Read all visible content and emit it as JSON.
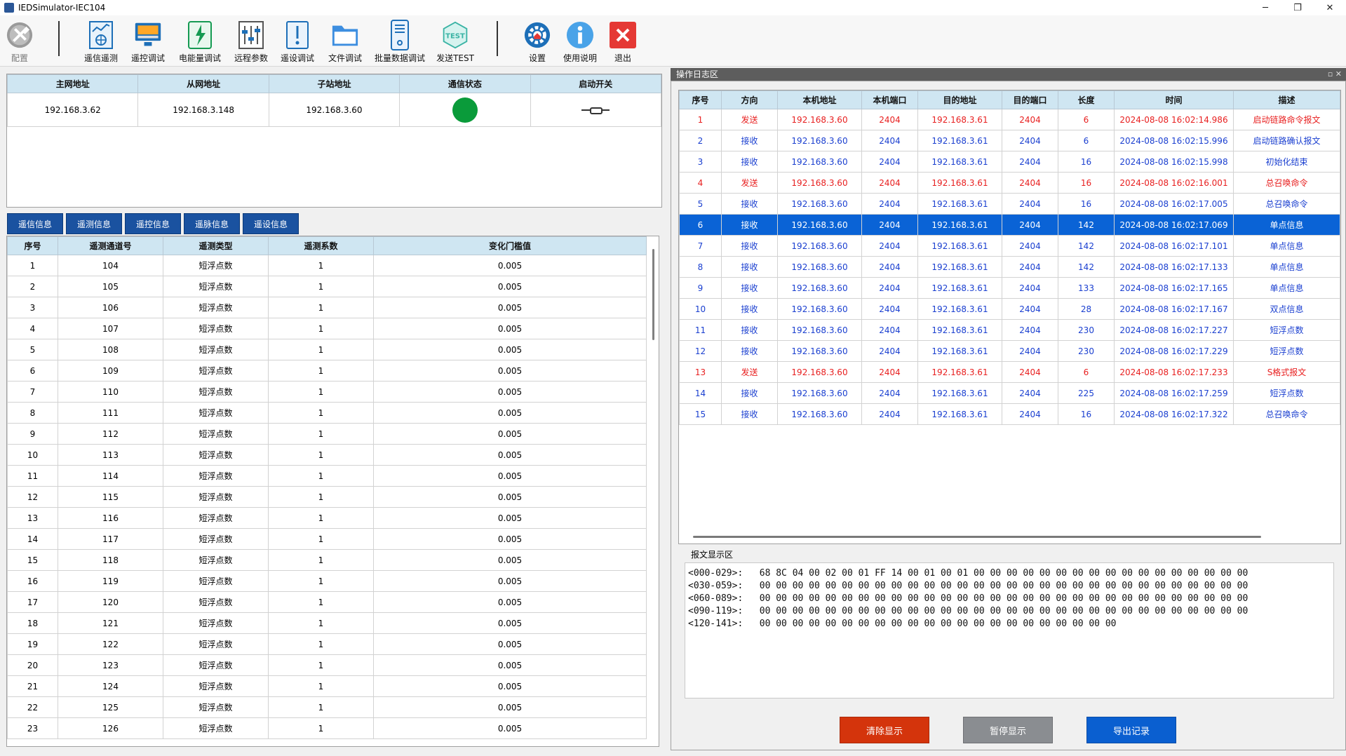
{
  "window": {
    "title": "IEDSimulator-IEC104",
    "minimize": "─",
    "maximize": "❐",
    "close": "✕"
  },
  "toolbar": {
    "items": [
      {
        "label": "配置",
        "icon": "config-tools-icon"
      },
      {
        "label": "遥信遥测",
        "icon": "chart-monitor-icon"
      },
      {
        "label": "遥控调试",
        "icon": "remote-screen-icon"
      },
      {
        "label": "电能量调试",
        "icon": "energy-meter-icon"
      },
      {
        "label": "远程参数",
        "icon": "sliders-icon"
      },
      {
        "label": "遥设调试",
        "icon": "alert-doc-icon"
      },
      {
        "label": "文件调试",
        "icon": "folder-icon"
      },
      {
        "label": "批量数据调试",
        "icon": "server-icon"
      },
      {
        "label": "发送TEST",
        "icon": "test-badge-icon"
      },
      {
        "label": "设置",
        "icon": "settings-icon"
      },
      {
        "label": "使用说明",
        "icon": "info-icon"
      },
      {
        "label": "退出",
        "icon": "exit-icon"
      }
    ]
  },
  "connection": {
    "headers": [
      "主网地址",
      "从网地址",
      "子站地址",
      "通信状态",
      "启动开关"
    ],
    "row": {
      "master": "192.168.3.62",
      "slave": "192.168.3.148",
      "substation": "192.168.3.60",
      "status_color": "#0a9b3a"
    }
  },
  "tabs": [
    "遥信信息",
    "遥测信息",
    "遥控信息",
    "遥脉信息",
    "遥设信息"
  ],
  "telemetry": {
    "headers": [
      "序号",
      "遥测通道号",
      "遥测类型",
      "遥测系数",
      "变化门槛值"
    ],
    "rows": [
      [
        "1",
        "104",
        "短浮点数",
        "1",
        "0.005"
      ],
      [
        "2",
        "105",
        "短浮点数",
        "1",
        "0.005"
      ],
      [
        "3",
        "106",
        "短浮点数",
        "1",
        "0.005"
      ],
      [
        "4",
        "107",
        "短浮点数",
        "1",
        "0.005"
      ],
      [
        "5",
        "108",
        "短浮点数",
        "1",
        "0.005"
      ],
      [
        "6",
        "109",
        "短浮点数",
        "1",
        "0.005"
      ],
      [
        "7",
        "110",
        "短浮点数",
        "1",
        "0.005"
      ],
      [
        "8",
        "111",
        "短浮点数",
        "1",
        "0.005"
      ],
      [
        "9",
        "112",
        "短浮点数",
        "1",
        "0.005"
      ],
      [
        "10",
        "113",
        "短浮点数",
        "1",
        "0.005"
      ],
      [
        "11",
        "114",
        "短浮点数",
        "1",
        "0.005"
      ],
      [
        "12",
        "115",
        "短浮点数",
        "1",
        "0.005"
      ],
      [
        "13",
        "116",
        "短浮点数",
        "1",
        "0.005"
      ],
      [
        "14",
        "117",
        "短浮点数",
        "1",
        "0.005"
      ],
      [
        "15",
        "118",
        "短浮点数",
        "1",
        "0.005"
      ],
      [
        "16",
        "119",
        "短浮点数",
        "1",
        "0.005"
      ],
      [
        "17",
        "120",
        "短浮点数",
        "1",
        "0.005"
      ],
      [
        "18",
        "121",
        "短浮点数",
        "1",
        "0.005"
      ],
      [
        "19",
        "122",
        "短浮点数",
        "1",
        "0.005"
      ],
      [
        "20",
        "123",
        "短浮点数",
        "1",
        "0.005"
      ],
      [
        "21",
        "124",
        "短浮点数",
        "1",
        "0.005"
      ],
      [
        "22",
        "125",
        "短浮点数",
        "1",
        "0.005"
      ],
      [
        "23",
        "126",
        "短浮点数",
        "1",
        "0.005"
      ]
    ]
  },
  "log": {
    "title": "操作日志区",
    "title_controls": "▫ ✕",
    "headers": [
      "序号",
      "方向",
      "本机地址",
      "本机端口",
      "目的地址",
      "目的端口",
      "长度",
      "时间",
      "描述"
    ],
    "selected_index": 5,
    "rows": [
      {
        "dir": "send",
        "cells": [
          "1",
          "发送",
          "192.168.3.60",
          "2404",
          "192.168.3.61",
          "2404",
          "6",
          "2024-08-08 16:02:14.986",
          "启动链路命令报文"
        ]
      },
      {
        "dir": "recv",
        "cells": [
          "2",
          "接收",
          "192.168.3.60",
          "2404",
          "192.168.3.61",
          "2404",
          "6",
          "2024-08-08 16:02:15.996",
          "启动链路确认报文"
        ]
      },
      {
        "dir": "recv",
        "cells": [
          "3",
          "接收",
          "192.168.3.60",
          "2404",
          "192.168.3.61",
          "2404",
          "16",
          "2024-08-08 16:02:15.998",
          "初始化结束"
        ]
      },
      {
        "dir": "send",
        "cells": [
          "4",
          "发送",
          "192.168.3.60",
          "2404",
          "192.168.3.61",
          "2404",
          "16",
          "2024-08-08 16:02:16.001",
          "总召唤命令"
        ]
      },
      {
        "dir": "recv",
        "cells": [
          "5",
          "接收",
          "192.168.3.60",
          "2404",
          "192.168.3.61",
          "2404",
          "16",
          "2024-08-08 16:02:17.005",
          "总召唤命令"
        ]
      },
      {
        "dir": "recv",
        "cells": [
          "6",
          "接收",
          "192.168.3.60",
          "2404",
          "192.168.3.61",
          "2404",
          "142",
          "2024-08-08 16:02:17.069",
          "单点信息"
        ]
      },
      {
        "dir": "recv",
        "cells": [
          "7",
          "接收",
          "192.168.3.60",
          "2404",
          "192.168.3.61",
          "2404",
          "142",
          "2024-08-08 16:02:17.101",
          "单点信息"
        ]
      },
      {
        "dir": "recv",
        "cells": [
          "8",
          "接收",
          "192.168.3.60",
          "2404",
          "192.168.3.61",
          "2404",
          "142",
          "2024-08-08 16:02:17.133",
          "单点信息"
        ]
      },
      {
        "dir": "recv",
        "cells": [
          "9",
          "接收",
          "192.168.3.60",
          "2404",
          "192.168.3.61",
          "2404",
          "133",
          "2024-08-08 16:02:17.165",
          "单点信息"
        ]
      },
      {
        "dir": "recv",
        "cells": [
          "10",
          "接收",
          "192.168.3.60",
          "2404",
          "192.168.3.61",
          "2404",
          "28",
          "2024-08-08 16:02:17.167",
          "双点信息"
        ]
      },
      {
        "dir": "recv",
        "cells": [
          "11",
          "接收",
          "192.168.3.60",
          "2404",
          "192.168.3.61",
          "2404",
          "230",
          "2024-08-08 16:02:17.227",
          "短浮点数"
        ]
      },
      {
        "dir": "recv",
        "cells": [
          "12",
          "接收",
          "192.168.3.60",
          "2404",
          "192.168.3.61",
          "2404",
          "230",
          "2024-08-08 16:02:17.229",
          "短浮点数"
        ]
      },
      {
        "dir": "send",
        "cells": [
          "13",
          "发送",
          "192.168.3.60",
          "2404",
          "192.168.3.61",
          "2404",
          "6",
          "2024-08-08 16:02:17.233",
          "S格式报文"
        ]
      },
      {
        "dir": "recv",
        "cells": [
          "14",
          "接收",
          "192.168.3.60",
          "2404",
          "192.168.3.61",
          "2404",
          "225",
          "2024-08-08 16:02:17.259",
          "短浮点数"
        ]
      },
      {
        "dir": "recv",
        "cells": [
          "15",
          "接收",
          "192.168.3.60",
          "2404",
          "192.168.3.61",
          "2404",
          "16",
          "2024-08-08 16:02:17.322",
          "总召唤命令"
        ]
      }
    ]
  },
  "message": {
    "label": "报文显示区",
    "lines": [
      "<000-029>:   68 8C 04 00 02 00 01 FF 14 00 01 00 01 00 00 00 00 00 00 00 00 00 00 00 00 00 00 00 00 00",
      "<030-059>:   00 00 00 00 00 00 00 00 00 00 00 00 00 00 00 00 00 00 00 00 00 00 00 00 00 00 00 00 00 00",
      "<060-089>:   00 00 00 00 00 00 00 00 00 00 00 00 00 00 00 00 00 00 00 00 00 00 00 00 00 00 00 00 00 00",
      "<090-119>:   00 00 00 00 00 00 00 00 00 00 00 00 00 00 00 00 00 00 00 00 00 00 00 00 00 00 00 00 00 00",
      "<120-141>:   00 00 00 00 00 00 00 00 00 00 00 00 00 00 00 00 00 00 00 00 00 00"
    ]
  },
  "buttons": {
    "clear": {
      "label": "清除显示",
      "color": "#d4340c"
    },
    "pause": {
      "label": "暂停显示",
      "color": "#8a8d91"
    },
    "export": {
      "label": "导出记录",
      "color": "#0a5fd0"
    }
  }
}
